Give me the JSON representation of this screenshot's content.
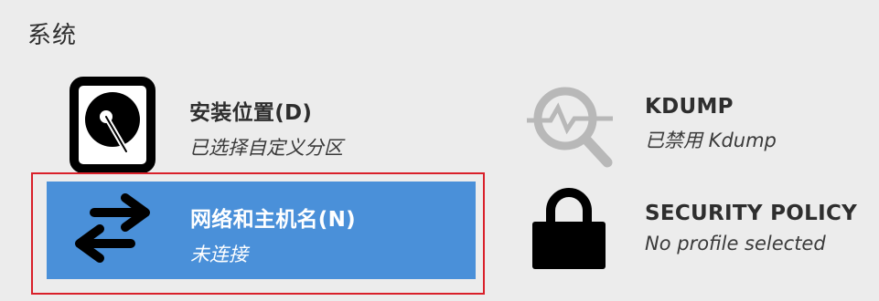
{
  "section": {
    "title": "系统"
  },
  "spokes": {
    "install_destination": {
      "name": "安装位置(D)",
      "status": "已选择自定义分区",
      "icon": "hard-disk-icon"
    },
    "kdump": {
      "name": "KDUMP",
      "status": "已禁用 Kdump",
      "icon": "kdump-magnifier-icon"
    },
    "network": {
      "name": "网络和主机名(N)",
      "status": "未连接",
      "icon": "network-arrows-icon",
      "selected": true
    },
    "security": {
      "name": "SECURITY POLICY",
      "status": "No profile selected",
      "icon": "lock-icon"
    }
  },
  "colors": {
    "background": "#ececec",
    "selected_fill": "#4a90d9",
    "focus_border": "#d9202a",
    "kdump_icon": "#b8b8b8"
  }
}
